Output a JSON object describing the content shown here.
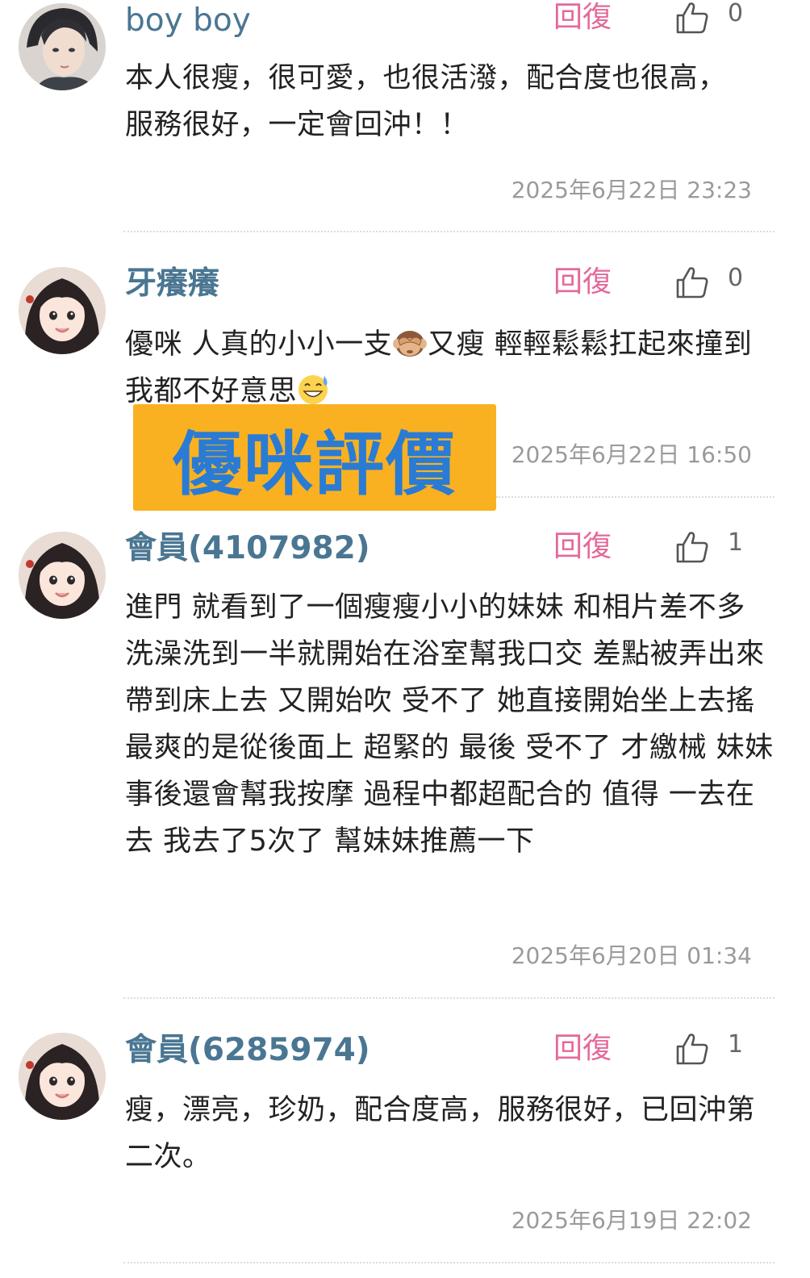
{
  "colors": {
    "username": "#4a7692",
    "reply": "#e4699a",
    "text": "#222222",
    "timestamp": "#9a9a9a",
    "banner_bg": "#f9b121",
    "banner_text": "#2a7bd4"
  },
  "comments": [
    {
      "username": "boy boy",
      "reply_label": "回復",
      "like_count": "0",
      "text": "本人很瘦，很可愛，也很活潑，配合度也很高，服務很好，一定會回沖！！",
      "timestamp": "2025年6月22日 23:23",
      "avatar_icon": "male-avatar-icon"
    },
    {
      "username": "牙癢癢",
      "reply_label": "回復",
      "like_count": "0",
      "text_part1": "優咪 人真的小小一支",
      "emoji1": "see-no-evil-monkey-emoji",
      "text_part2": "又瘦 輕輕鬆鬆扛起來撞到我都不好意思",
      "emoji2": "grinning-sweat-emoji",
      "timestamp": "2025年6月22日 16:50",
      "avatar_icon": "female-avatar-icon"
    },
    {
      "username": "會員(4107982)",
      "reply_label": "回復",
      "like_count": "1",
      "text": "進門 就看到了一個瘦瘦小小的妹妹 和相片差不多 洗澡洗到一半就開始在浴室幫我口交 差點被弄出來 帶到床上去 又開始吹 受不了 她直接開始坐上去搖 最爽的是從後面上 超緊的 最後 受不了 才繳械 妹妹事後還會幫我按摩 過程中都超配合的 值得 一去在去 我去了5次了 幫妹妹推薦一下",
      "timestamp": "2025年6月20日 01:34",
      "avatar_icon": "female-avatar-icon"
    },
    {
      "username": "會員(6285974)",
      "reply_label": "回復",
      "like_count": "1",
      "text": "瘦，漂亮，珍奶，配合度高，服務很好，已回沖第二次。",
      "timestamp": "2025年6月19日 22:02",
      "avatar_icon": "female-avatar-icon"
    }
  ],
  "banner": {
    "text": "優咪評價"
  }
}
